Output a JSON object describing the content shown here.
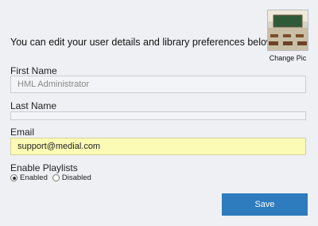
{
  "intro_text": "You can edit your user details and library preferences below.",
  "profile": {
    "change_pic_label": "Change Pic"
  },
  "fields": {
    "first_name": {
      "label": "First Name",
      "value": "HML Administrator"
    },
    "last_name": {
      "label": "Last Name",
      "value": ""
    },
    "email": {
      "label": "Email",
      "value": "support@medial.com"
    }
  },
  "playlists": {
    "label": "Enable Playlists",
    "options": [
      "Enabled",
      "Disabled"
    ],
    "selected": "Enabled"
  },
  "save_label": "Save",
  "colors": {
    "accent": "#2e7bbd",
    "email_highlight": "#fbfbb6"
  },
  "icons": {
    "avatar": "classroom-photo"
  }
}
